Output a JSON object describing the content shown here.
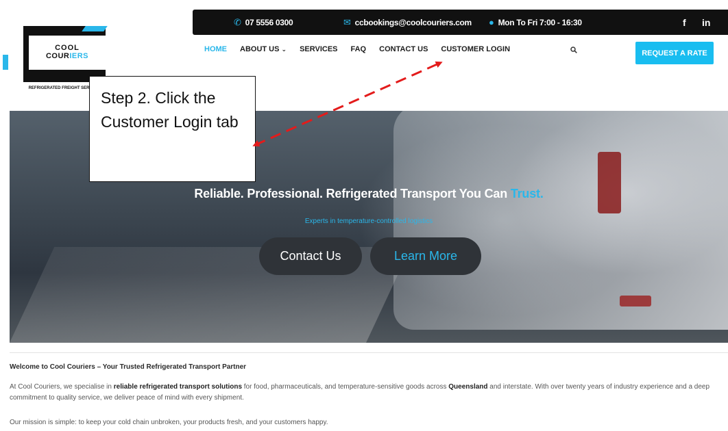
{
  "topbar": {
    "phone": "07 5556 0300",
    "email": "ccbookings@coolcouriers.com",
    "hours": "Mon To Fri 7:00 - 16:30",
    "facebook": "f",
    "linkedin": "in"
  },
  "logo": {
    "line1": "COOL",
    "line2_a": "COUR",
    "line2_b": "IERS",
    "sub": "REFRIGERATED FREIGHT SERVICES"
  },
  "nav": {
    "home": "HOME",
    "about": "ABOUT US",
    "services": "SERVICES",
    "faq": "FAQ",
    "contact": "CONTACT US",
    "login": "CUSTOMER LOGIN"
  },
  "cta": "REQUEST A RATE",
  "hero": {
    "title": "Reliable. Professional. Refrigerated Transport You Can",
    "title_highlight": "Trust.",
    "subtitle": "Experts in temperature-controlled logistics",
    "contact_button": "Contact Us",
    "learn_button": "Learn More"
  },
  "content": {
    "welcome": "Welcome to Cool Couriers – Your Trusted Refrigerated Transport Partner",
    "p1_a": "At Cool Couriers, we specialise in ",
    "p1_b": "reliable refrigerated transport solutions",
    "p1_c": " for food, pharmaceuticals, and temperature-sensitive goods across ",
    "p1_d": "Queensland",
    "p1_e": " and interstate. With over twenty years of industry experience and a deep commitment to quality service, we deliver peace of mind with every shipment.",
    "p2": "Our mission is simple: to keep your cold chain unbroken, your products fresh, and your customers happy."
  },
  "callout": {
    "text": "Step 2. Click the Customer Login tab"
  },
  "colors": {
    "accent": "#2ab7ea",
    "dark": "#111111",
    "arrow": "#e31b1b"
  }
}
